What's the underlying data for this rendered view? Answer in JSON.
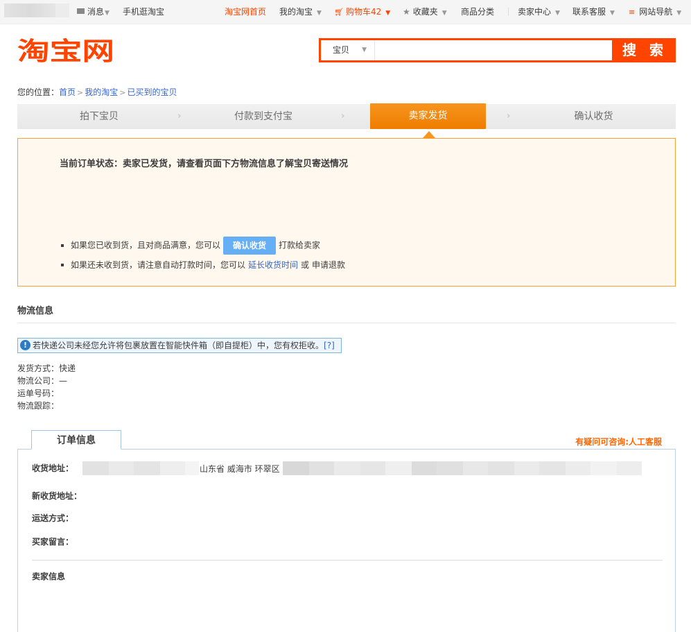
{
  "topbar": {
    "messages": "消息",
    "mobile": "手机逛淘宝",
    "home": "淘宝网首页",
    "my_taobao": "我的淘宝",
    "cart": "购物车",
    "cart_count": "42",
    "favorites": "收藏夹",
    "categories": "商品分类",
    "seller_center": "卖家中心",
    "customer_service": "联系客服",
    "site_nav": "网站导航"
  },
  "header": {
    "logo": "淘宝网",
    "search_type": "宝贝",
    "search_value": "",
    "search_button": "搜 索"
  },
  "breadcrumb": {
    "prefix": "您的位置：",
    "items": [
      "首页",
      "我的淘宝",
      "已买到的宝贝"
    ]
  },
  "steps": [
    {
      "label": "拍下宝贝",
      "active": false
    },
    {
      "label": "付款到支付宝",
      "active": false
    },
    {
      "label": "卖家发货",
      "active": true
    },
    {
      "label": "确认收货",
      "active": false
    }
  ],
  "status": {
    "title": "当前订单状态：卖家已发货，请查看页面下方物流信息了解宝贝寄送情况",
    "line1_pre": "如果您已收到货，且对商品满意，您可以",
    "confirm_button": "确认收货",
    "line1_post": "打款给卖家",
    "line2_pre": "如果还未收到货，请注意自动打款时间，您可以",
    "extend_link": "延长收货时间",
    "line2_or": "或",
    "refund": "申请退款"
  },
  "logistics": {
    "title": "物流信息",
    "notice": "若快递公司未经您允许将包裹放置在智能快件箱（即自提柜）中，您有权拒收。",
    "notice_link": "[?]",
    "ship_method": "发货方式：快递",
    "company": "物流公司：—",
    "waybill": "运单号码：",
    "tracking": "物流跟踪："
  },
  "order": {
    "tab": "订单信息",
    "service": "有疑问可咨询:人工客服",
    "address_label": "收货地址：",
    "address_visible": "山东省 威海市 环翠区",
    "new_address_label": "新收货地址：",
    "shipping_label": "运送方式：",
    "message_label": "买家留言：",
    "seller_info": "卖家信息"
  },
  "colors": {
    "brand": "#ff4400",
    "step_active": "#f7951d",
    "confirm_button": "#66aff5",
    "status_bg": "#fff8ef",
    "link": "#3366cc"
  }
}
